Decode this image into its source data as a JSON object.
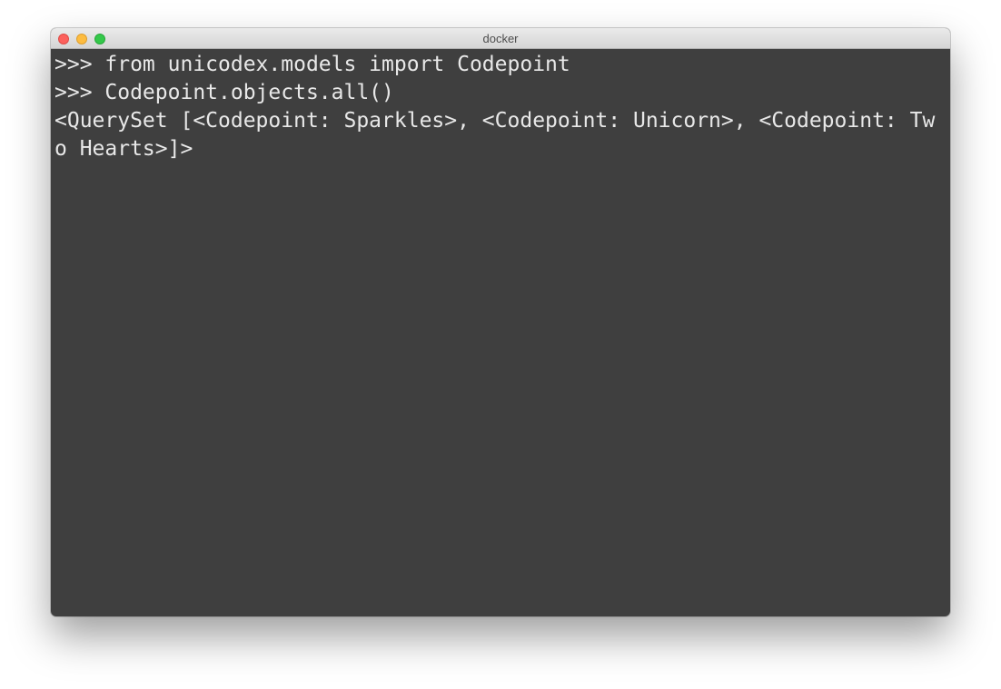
{
  "window": {
    "title": "docker"
  },
  "terminal": {
    "lines": [
      ">>> from unicodex.models import Codepoint",
      ">>> Codepoint.objects.all()",
      "<QuerySet [<Codepoint: Sparkles>, <Codepoint: Unicorn>, <Codepoint: Tw",
      "o Hearts>]>"
    ],
    "prompt": ">>> "
  },
  "colors": {
    "terminal_background": "#3f3f3f",
    "terminal_text": "#e8e8e8",
    "cursor": "#c7c7c7",
    "close_button": "#fc605c",
    "minimize_button": "#fdbc40",
    "maximize_button": "#34c84a"
  },
  "icons": {
    "close": "close-icon",
    "minimize": "minimize-icon",
    "maximize": "maximize-icon"
  }
}
